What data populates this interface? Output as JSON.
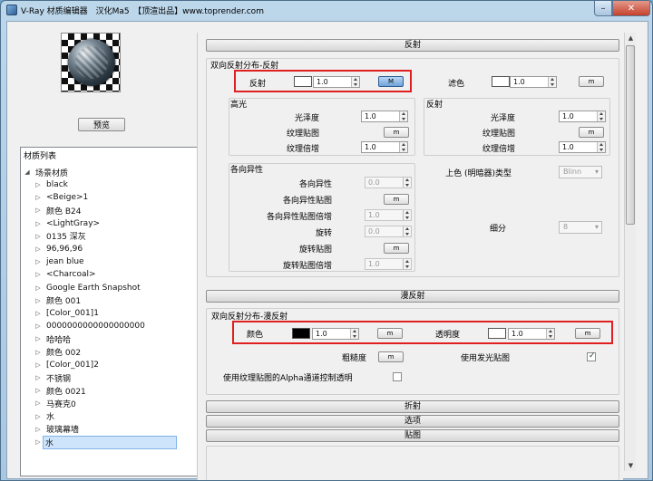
{
  "window": {
    "title": "V-Ray 材质编辑器　汉化Ma5　【顶渲出品】www.toprender.com"
  },
  "preview": {
    "button_label": "预览"
  },
  "material_list": {
    "title": "材质列表",
    "root": "场景材质",
    "items": [
      "black",
      "<Beige>1",
      "颜色 B24",
      "<LightGray>",
      "0135 深灰",
      "96,96,96",
      "jean blue",
      "<Charcoal>",
      "Google Earth Snapshot",
      "颜色 001",
      "[Color_001]1",
      "0000000000000000000",
      "哈哈哈",
      "颜色 002",
      "[Color_001]2",
      "不锈钢",
      "颜色 0021",
      "马赛克0",
      "水",
      "玻璃幕墙",
      "水"
    ],
    "selected_index": 20
  },
  "reflection": {
    "header": "反射",
    "group_title": "双向反射分布-反射",
    "reflect_label": "反射",
    "reflect_value": "1.0",
    "reflect_swatch": "#ffffff",
    "reflect_map_label": "M",
    "filter_label": "滤色",
    "filter_value": "1.0",
    "filter_swatch": "#ffffff",
    "filter_map_label": "m",
    "highlight": {
      "title": "高光",
      "gloss_label": "光泽度",
      "gloss_value": "1.0",
      "texmap_label": "纹理贴图",
      "texmap_btn": "m",
      "mult_label": "纹理倍增",
      "mult_value": "1.0"
    },
    "refl": {
      "title": "反射",
      "gloss_label": "光泽度",
      "gloss_value": "1.0",
      "texmap_label": "纹理贴图",
      "texmap_btn": "m",
      "mult_label": "纹理倍增",
      "mult_value": "1.0"
    },
    "aniso": {
      "title": "各向异性",
      "aniso_label": "各向异性",
      "aniso_value": "0.0",
      "aniso_map_label": "各向异性贴图",
      "aniso_map_btn": "m",
      "aniso_mult_label": "各向异性贴图倍增",
      "aniso_mult_value": "1.0",
      "rot_label": "旋转",
      "rot_value": "0.0",
      "rot_map_label": "旋转贴图",
      "rot_map_btn": "m",
      "rot_mult_label": "旋转贴图倍增",
      "rot_mult_value": "1.0"
    },
    "shade_label": "上色 (明暗器)类型",
    "shade_value": "Blinn",
    "subdiv_label": "细分",
    "subdiv_value": "8"
  },
  "diffuse": {
    "header": "漫反射",
    "group_title": "双向反射分布-漫反射",
    "color_label": "颜色",
    "color_value": "1.0",
    "color_swatch": "#000000",
    "color_map": "m",
    "trans_label": "透明度",
    "trans_value": "1.0",
    "trans_swatch": "#ffffff",
    "trans_map": "m",
    "rough_label": "粗糙度",
    "rough_map": "m",
    "emit_label": "使用发光贴图",
    "alpha_label": "使用纹理贴图的Alpha通道控制透明"
  },
  "sections": {
    "refraction": "折射",
    "options": "选项",
    "maps": "贴图"
  }
}
